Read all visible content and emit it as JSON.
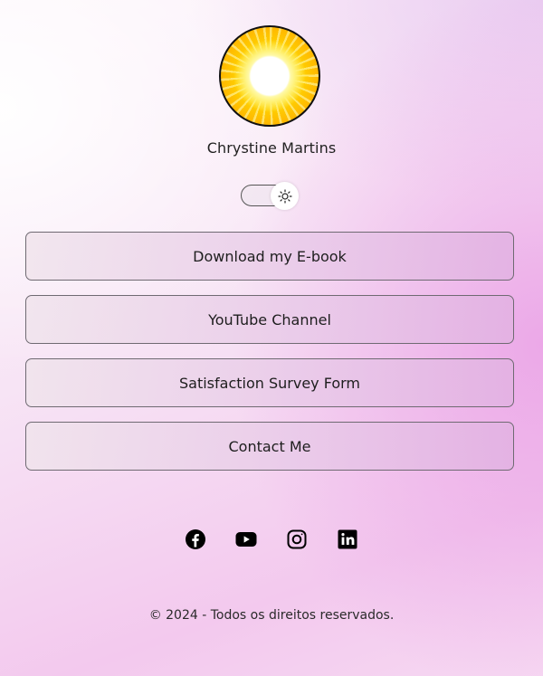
{
  "profile": {
    "name": "Chrystine Martins"
  },
  "theme_toggle": {
    "state": "light",
    "icon": "sun-icon"
  },
  "links": [
    {
      "label": "Download my E-book"
    },
    {
      "label": "YouTube Channel"
    },
    {
      "label": "Satisfaction Survey Form"
    },
    {
      "label": "Contact Me"
    }
  ],
  "socials": [
    {
      "icon": "facebook-icon"
    },
    {
      "icon": "youtube-icon"
    },
    {
      "icon": "instagram-icon"
    },
    {
      "icon": "linkedin-icon"
    }
  ],
  "footer": {
    "text": "© 2024 - Todos os direitos reservados."
  },
  "colors": {
    "avatar_sun": "#ffd200",
    "text": "#1d1d1d",
    "button_border": "#6f6a72",
    "background_accent": "#f3c9ee"
  }
}
